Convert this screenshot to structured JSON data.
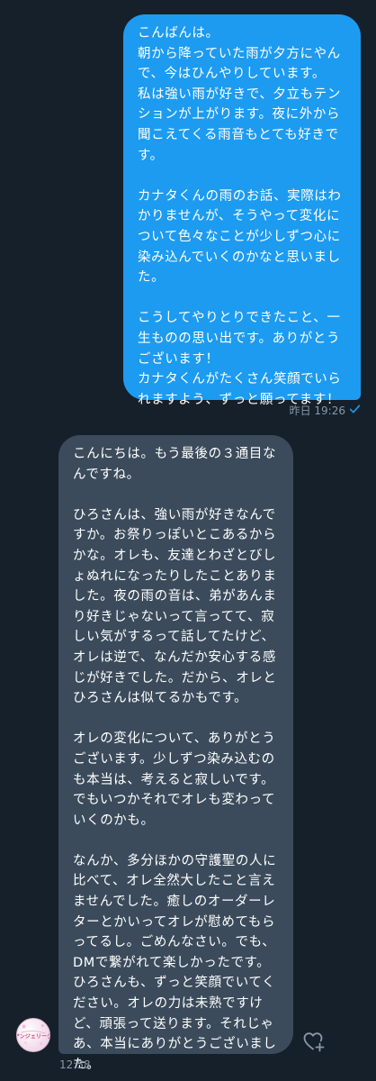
{
  "conversation": {
    "sent_message": {
      "text": "こんばんは。\n朝から降っていた雨が夕方にやんで、今はひんやりしています。\n私は強い雨が好きで、夕立もテンションが上がります。夜に外から聞こえてくる雨音もとても好きです。\n\nカナタくんの雨のお話、実際はわかりませんが、そうやって変化について色々なことが少しずつ心に染み込んでいくのかなと思いました。\n\nこうしてやりとりできたこと、一生ものの思い出です。ありがとうございます！\nカナタくんがたくさん笑顔でいられますよう、ずっと願ってます！",
      "timestamp": "昨日 19:26",
      "bubble_color": "#1d9bf0",
      "status_icon": "sent-check-icon"
    },
    "received_message": {
      "text": "こんにちは。もう最後の３通目なんですね。\n\nひろさんは、強い雨が好きなんですか。お祭りっぽいとこあるからかな。オレも、友達とわざとびしょぬれになったりしたことありました。夜の雨の音は、弟があんまり好きじゃないって言ってて、寂しい気がするって話してたけど、オレは逆で、なんだか安心する感じが好きでした。だから、オレとひろさんは似てるかもです。\n\nオレの変化について、ありがとうございます。少しずつ染み込むのも本当は、考えると寂しいです。でもいつかそれでオレも変わっていくのかも。\n\nなんか、多分ほかの守護聖の人に比べて、オレ全然大したこと言えませんでした。癒しのオーダーレターとかいってオレが慰めてもらってるし。ごめんなさい。でも、DMで繋がれて楽しかったです。ひろさんも、ずっと笑顔でいてください。オレの力は未熟ですけど、頑張って送ります。それじゃあ、本当にありがとうございました。",
      "timestamp": "12:58",
      "bubble_color": "#3b4b5b",
      "avatar_text": "アンジェリーク",
      "like_icon": "heart-plus-icon"
    }
  },
  "theme": {
    "background": "#15202b",
    "meta_text_color": "#8899a6"
  }
}
